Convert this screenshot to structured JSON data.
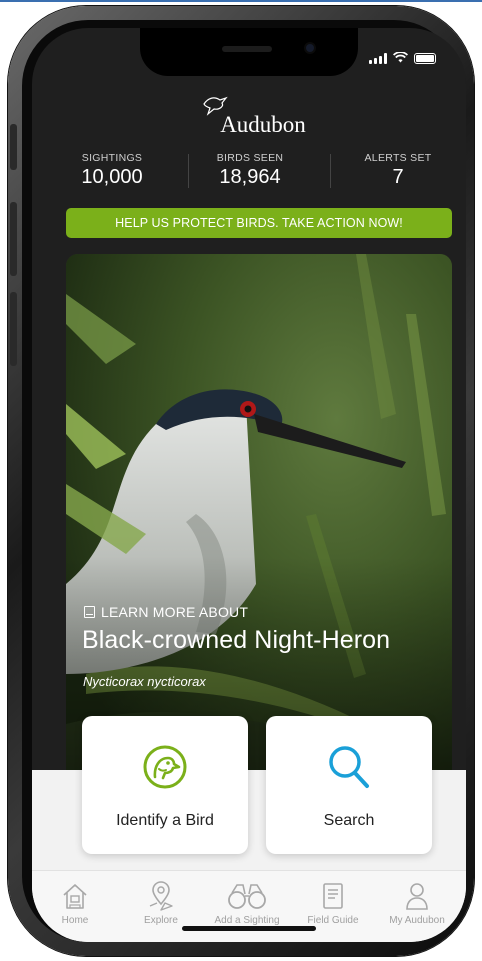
{
  "status_bar": {
    "icons": [
      "signal-icon",
      "wifi-icon",
      "battery-icon"
    ]
  },
  "brand": {
    "name": "Audubon"
  },
  "stats": [
    {
      "label": "SIGHTINGS",
      "value": "10,000"
    },
    {
      "label": "BIRDS SEEN",
      "value": "18,964"
    },
    {
      "label": "ALERTS SET",
      "value": "7"
    }
  ],
  "banner": {
    "text": "HELP US PROTECT BIRDS. TAKE ACTION NOW!"
  },
  "featured": {
    "kicker": "LEARN MORE ABOUT",
    "common_name": "Black-crowned Night-Heron",
    "scientific_name": "Nycticorax nycticorax"
  },
  "actions": [
    {
      "label": "Identify a Bird",
      "icon": "bird-head-icon"
    },
    {
      "label": "Search",
      "icon": "search-icon"
    }
  ],
  "tabs": [
    {
      "label": "Home",
      "icon": "home-icon"
    },
    {
      "label": "Explore",
      "icon": "map-pin-icon"
    },
    {
      "label": "Add a Sighting",
      "icon": "binoculars-icon"
    },
    {
      "label": "Field Guide",
      "icon": "book-icon"
    },
    {
      "label": "My Audubon",
      "icon": "person-icon"
    }
  ],
  "colors": {
    "accent_green": "#7bb01a",
    "search_blue": "#1aa0d8",
    "app_bg": "#1f1f1f"
  }
}
